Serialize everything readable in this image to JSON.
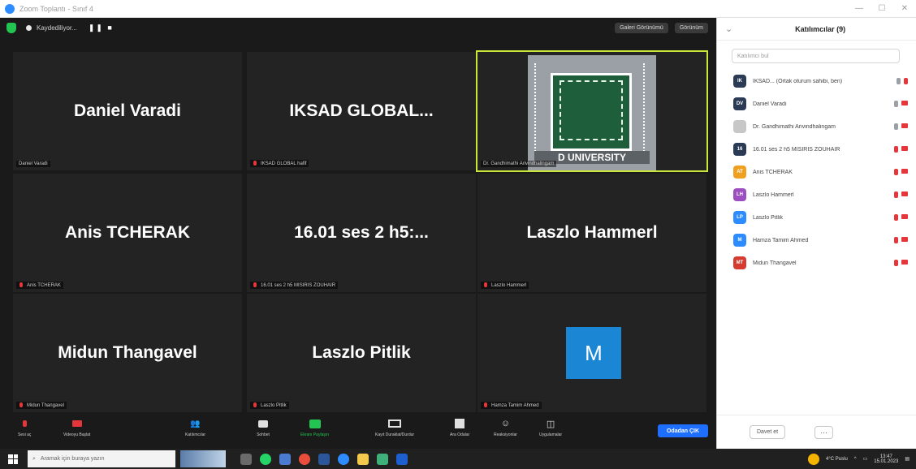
{
  "window": {
    "title": "Zoom Toplantı - Sınıf 4"
  },
  "topbar": {
    "recording_label": "Kaydediliyor...",
    "recording_controls": "❚❚ ■",
    "view_button": "Galeri Görünümü",
    "gallery_button": "Görünüm"
  },
  "tiles": [
    {
      "name": "Daniel Varadi",
      "caption": "Daniel Varadi",
      "muted": false
    },
    {
      "name": "IKSAD  GLOBAL...",
      "caption": "IKSAD GLOBAL hafif",
      "muted": true
    },
    {
      "name": "",
      "caption": "Dr. Gandhimathi Arivindhalingam",
      "muted": false,
      "logo_text": "D UNIVERSITY"
    },
    {
      "name": "Anis TCHERAK",
      "caption": "Anis TCHERAK",
      "muted": true
    },
    {
      "name": "16.01 ses 2 h5:...",
      "caption": "16.01 ses 2 h5 MISIRIS ZOUHAIR",
      "muted": true
    },
    {
      "name": "Laszlo Hammerl",
      "caption": "Laszlo Hammerl",
      "muted": true
    },
    {
      "name": "Midun Thangavel",
      "caption": "Midun Thangavel",
      "muted": true
    },
    {
      "name": "Laszlo Pitlik",
      "caption": "Laszlo Pitlik",
      "muted": true
    },
    {
      "name": "",
      "caption": "Hamza Tamim Ahmed",
      "muted": true,
      "avatar_letter": "M"
    }
  ],
  "controls": {
    "unmute": "Sesi aç",
    "video": "Videoyu Başlat",
    "participants": "Katılımcılar",
    "chat": "Sohbet",
    "share": "Ekranı Paylaşın",
    "record": "Kayıt Duraklat/Durdur",
    "breakout": "Ara Odalar",
    "reactions": "Reaksiyonlar",
    "apps": "Uygulamalar",
    "end": "Odadan ÇIK"
  },
  "panel": {
    "title": "Katılımcılar (9)",
    "search_placeholder": "Katılımcı bul",
    "invite": "Davet et",
    "more": "···",
    "participants": [
      {
        "initials": "IK",
        "name": "IKSAD... (Ortak oturum sahibi, ben)",
        "color": "#2b3a55"
      },
      {
        "initials": "DV",
        "name": "Daniel Varadi",
        "color": "#2b3a55"
      },
      {
        "initials": "",
        "name": "Dr. Gandhimathi Arivindhalingam",
        "color": "#c7c7c7"
      },
      {
        "initials": "16",
        "name": "16.01 ses 2 h5 MISIRIS ZOUHAIR",
        "color": "#2b3a55"
      },
      {
        "initials": "AT",
        "name": "Anis TCHERAK",
        "color": "#f0a020"
      },
      {
        "initials": "LH",
        "name": "Laszlo Hammerl",
        "color": "#9b4fc0"
      },
      {
        "initials": "LP",
        "name": "Laszlo Pitlik",
        "color": "#2d8cff"
      },
      {
        "initials": "M",
        "name": "Hamza Tamim Ahmed",
        "color": "#2d8cff"
      },
      {
        "initials": "MT",
        "name": "Midun Thangavel",
        "color": "#d63b2f"
      }
    ]
  },
  "taskbar": {
    "search_placeholder": "Aramak için buraya yazın",
    "weather": "4°C Puslu",
    "time": "13:47",
    "date": "15.01.2023"
  },
  "colors": {
    "accent": "#1e6fff",
    "active_speaker": "#c9e63a",
    "muted": "#e5373b"
  }
}
